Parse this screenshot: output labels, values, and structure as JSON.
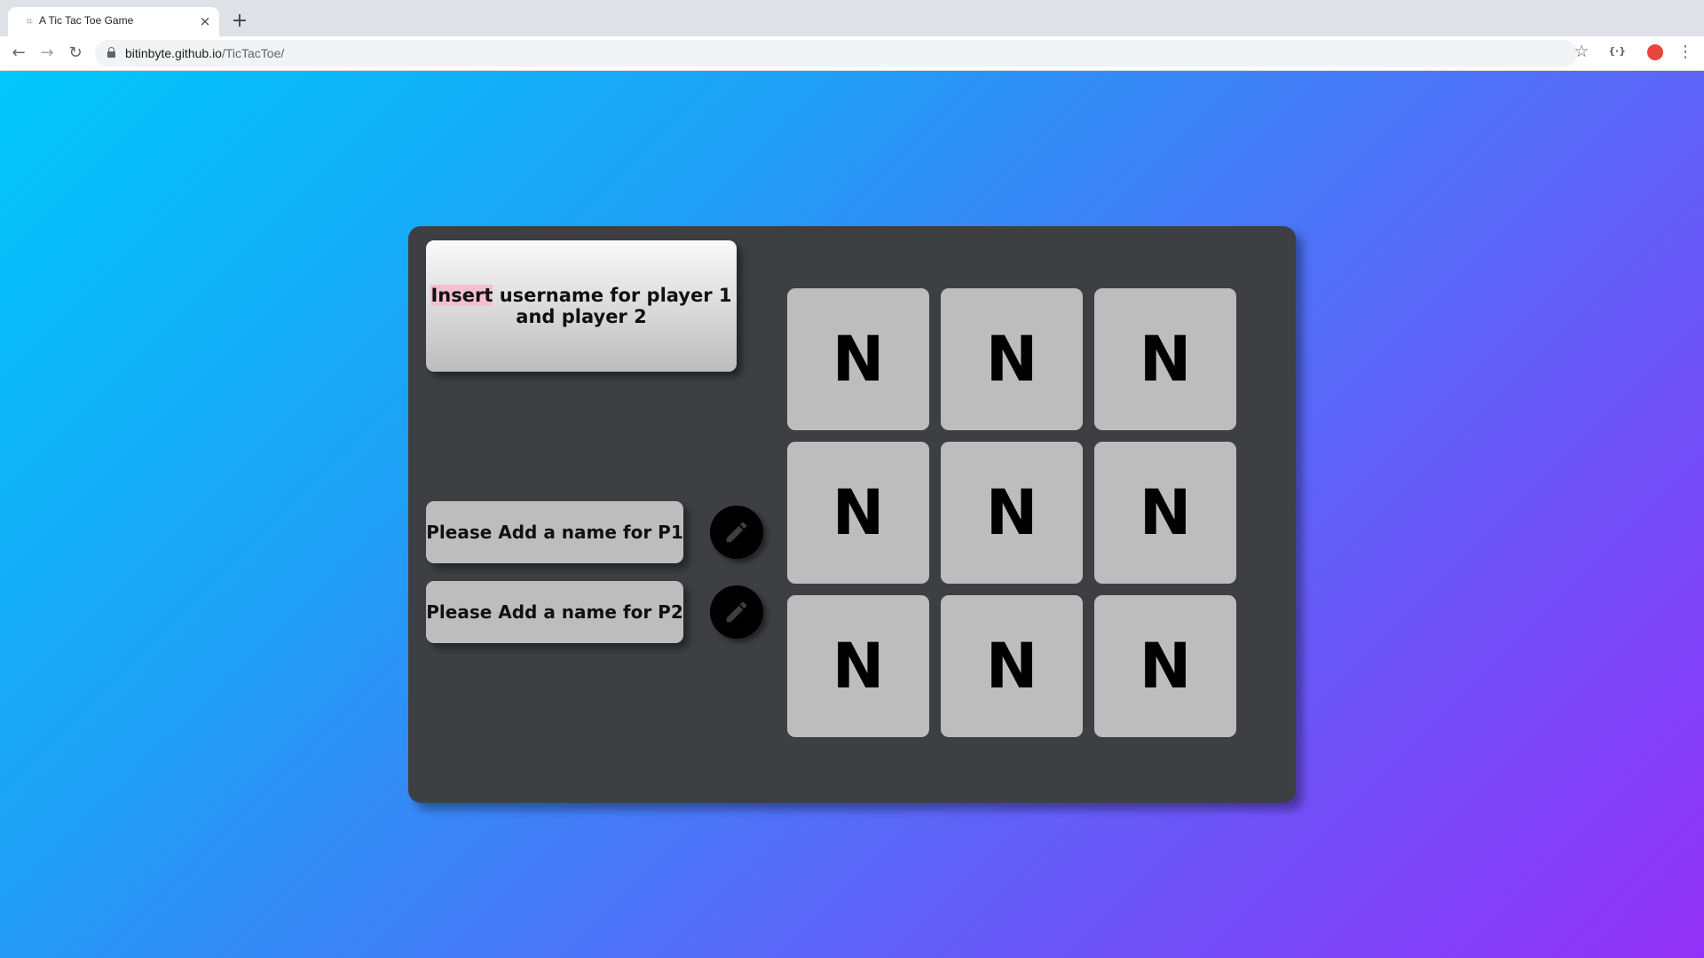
{
  "browser": {
    "tab_title": "A Tic Tac Toe Game",
    "tab_close": "×",
    "new_tab": "+",
    "url_host": "bitinbyte.github.io",
    "url_path": "/TicTacToe/",
    "ext_label": "{·}"
  },
  "game": {
    "message_highlight": "Insert",
    "message_rest": " username for player 1 and player 2",
    "players": [
      {
        "label": "Please Add a name for P1"
      },
      {
        "label": "Please Add a name for P2"
      }
    ],
    "board": [
      [
        "N",
        "N",
        "N"
      ],
      [
        "N",
        "N",
        "N"
      ],
      [
        "N",
        "N",
        "N"
      ]
    ]
  },
  "colors": {
    "card": "#3d3f43",
    "tile": "#bdbdbd",
    "highlight": "#f4bfd2",
    "gradient_start": "#00c8fb",
    "gradient_end": "#9330f7"
  }
}
